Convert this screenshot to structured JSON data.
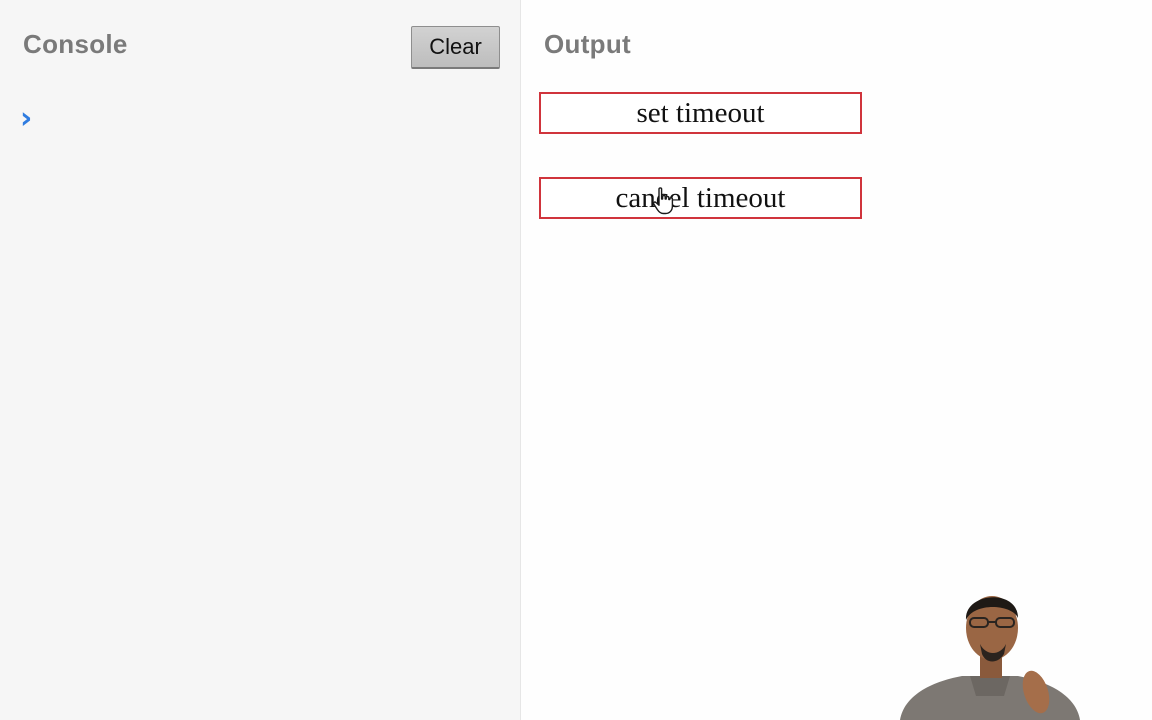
{
  "console": {
    "title": "Console",
    "clear_label": "Clear",
    "prompt_symbol": "›",
    "accent_color": "#2f7ce0"
  },
  "output": {
    "title": "Output",
    "buttons": [
      {
        "label": "set timeout"
      },
      {
        "label": "cancel timeout"
      }
    ],
    "button_border_color": "#d0343c"
  },
  "icons": {
    "cursor": "hand-pointer-icon",
    "prompt": "chevron-right-icon"
  }
}
